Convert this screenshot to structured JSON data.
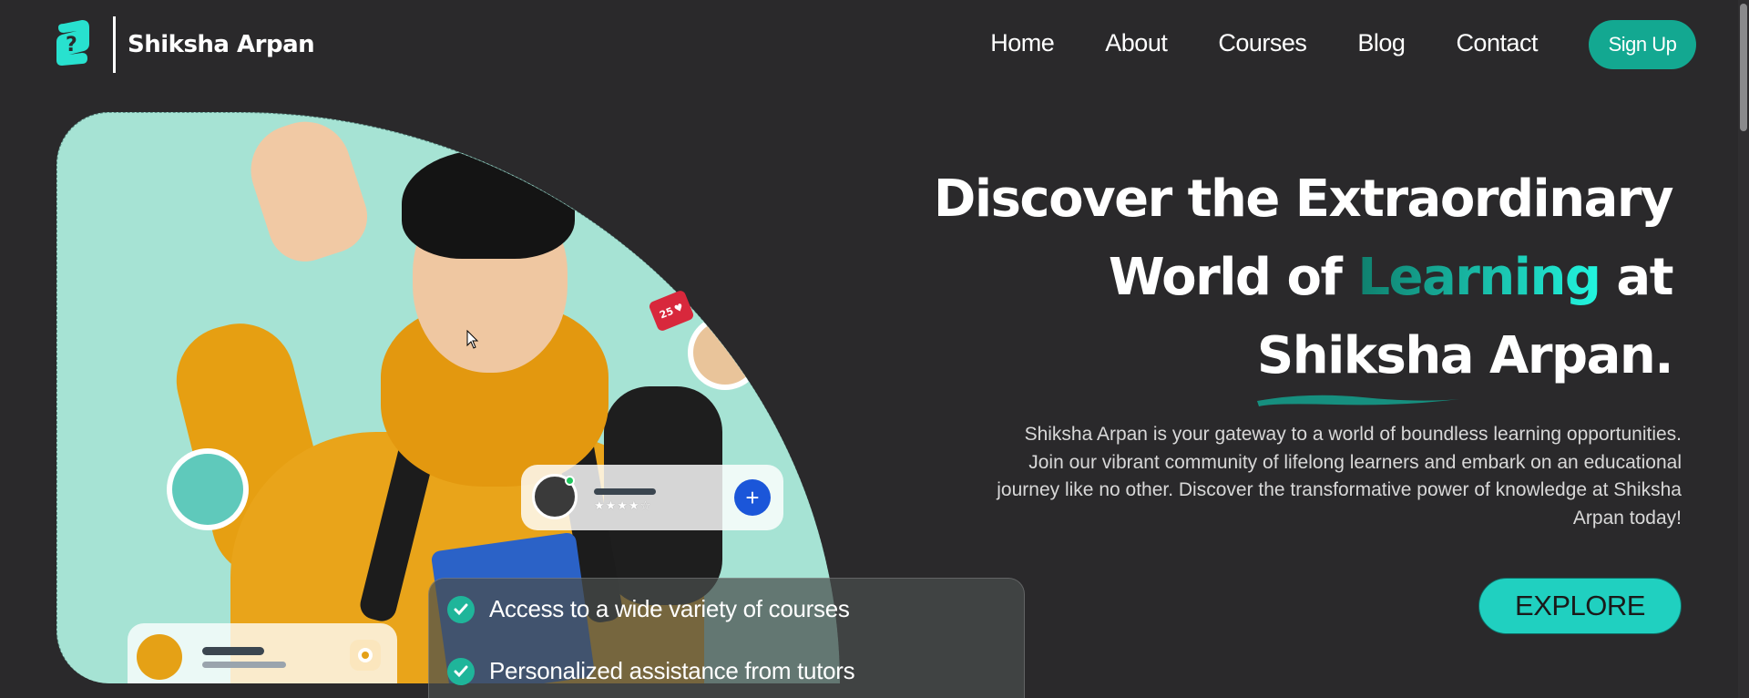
{
  "header": {
    "brand": "Shiksha Arpan",
    "nav": [
      "Home",
      "About",
      "Courses",
      "Blog",
      "Contact"
    ],
    "signup_label": "Sign Up"
  },
  "hero": {
    "headline_line1": "Discover the Extraordinary",
    "headline_line2_pre": "World of ",
    "headline_line2_accent": "Learning",
    "headline_line2_post": " at",
    "headline_line3_underlined": "Shiksha",
    "headline_line3_rest": " Arpan.",
    "description": "Shiksha Arpan is your gateway to a world of boundless learning opportunities. Join our vibrant community of lifelong learners and embark on an educational journey like no other. Discover the transformative power of knowledge at Shiksha Arpan today!",
    "explore_label": "EXPLORE"
  },
  "illustration": {
    "like_count": "25",
    "rating_stars": "★★★★☆"
  },
  "features": [
    "Access to a wide variety of courses",
    "Personalized assistance from tutors"
  ],
  "colors": {
    "accent": "#13a891",
    "background": "#2a292b",
    "hero_shape": "#a6e3d4"
  }
}
